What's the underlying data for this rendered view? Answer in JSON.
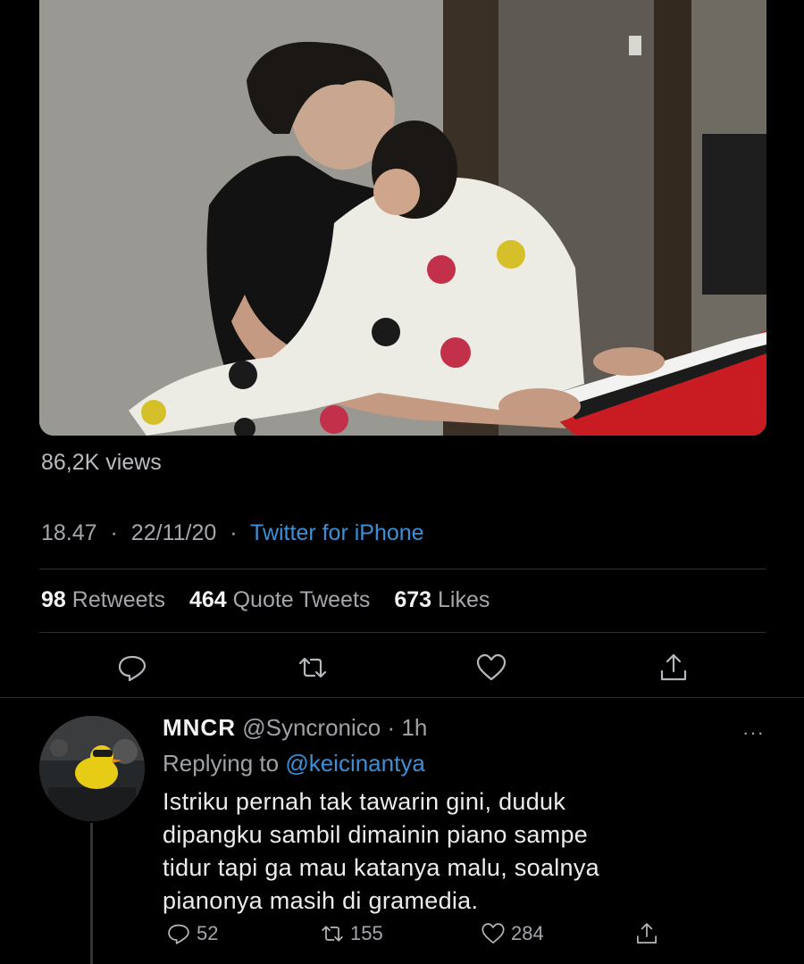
{
  "tweet": {
    "media_alt": "photo",
    "views": "86,2K views",
    "time": "18.47",
    "date": "22/11/20",
    "separator": "·",
    "source": "Twitter for iPhone",
    "stats": {
      "retweets_count": "98",
      "retweets_label": "Retweets",
      "quotes_count": "464",
      "quotes_label": "Quote Tweets",
      "likes_count": "673",
      "likes_label": "Likes"
    },
    "actions": [
      "reply-icon",
      "retweet-icon",
      "like-icon",
      "share-icon"
    ]
  },
  "reply": {
    "name": "MNCR",
    "handle": "@Syncronico",
    "separator": "·",
    "time": "1h",
    "more": "···",
    "replying_prefix": "Replying to",
    "replying_to": "@keicinantya",
    "text_lines": [
      "Istriku pernah tak tawarin gini, duduk",
      "dipangku sambil dimainin piano sampe",
      "tidur tapi ga mau katanya malu, soalnya",
      "pianonya masih di gramedia."
    ],
    "reply_count": "52",
    "retweet_count": "155",
    "like_count": "284"
  },
  "colors": {
    "background": "#000000",
    "link": "#3d8fd6",
    "muted": "#a3a7ab",
    "divider": "#2a2d30"
  }
}
